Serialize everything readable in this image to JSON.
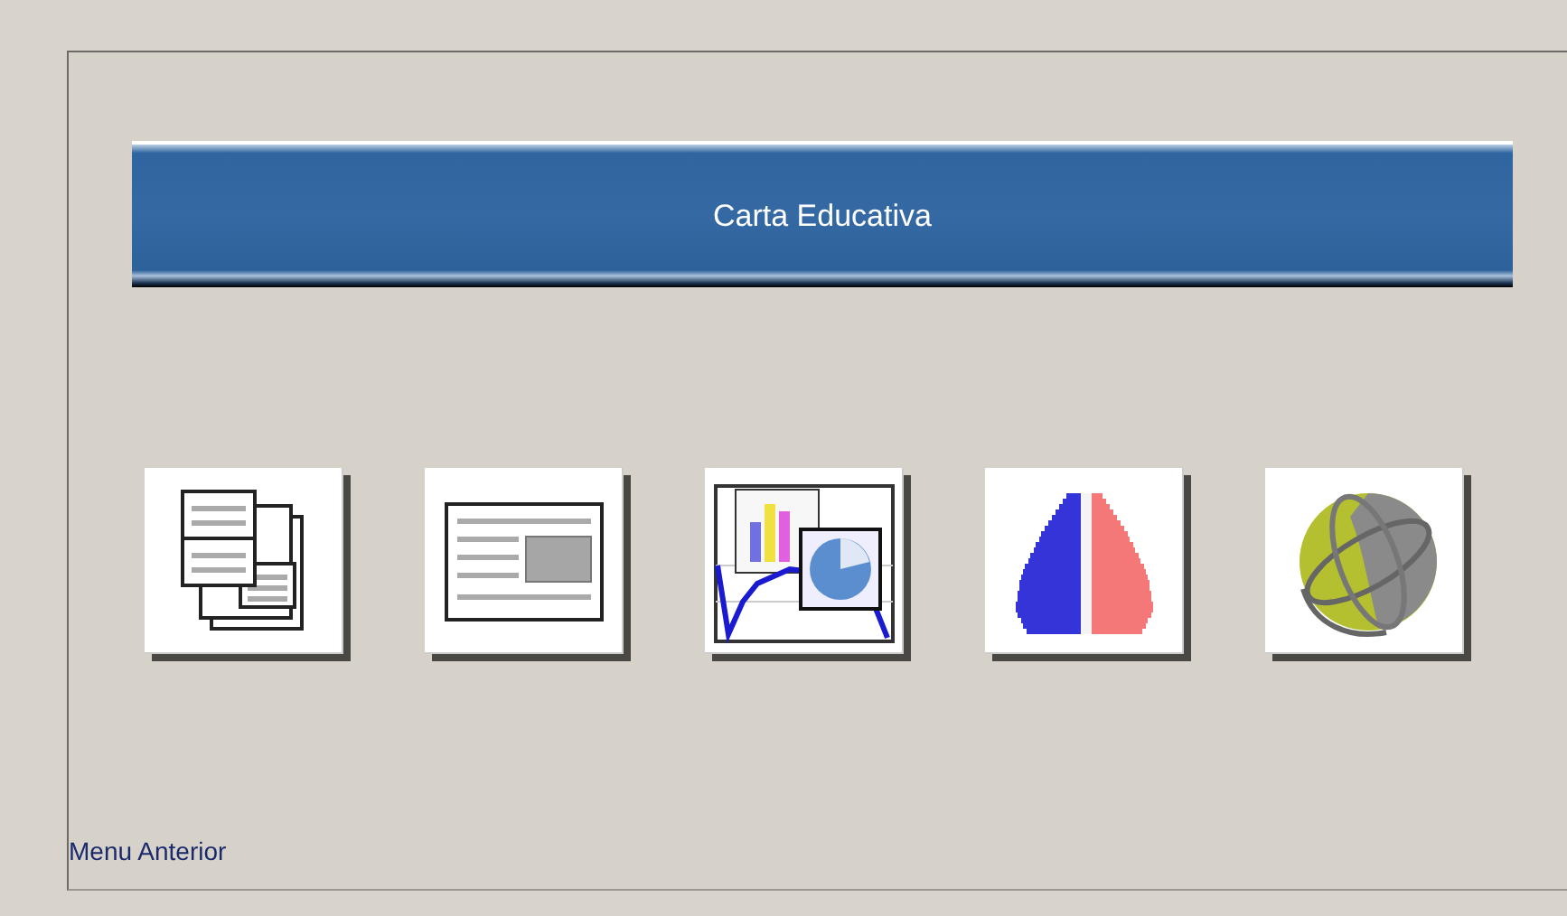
{
  "header": {
    "title": "Carta Educativa"
  },
  "buttons": [
    {
      "kind": "documents"
    },
    {
      "kind": "layout"
    },
    {
      "kind": "charts"
    },
    {
      "kind": "pyramid"
    },
    {
      "kind": "globe"
    }
  ],
  "footer_link": "Menu Anterior"
}
